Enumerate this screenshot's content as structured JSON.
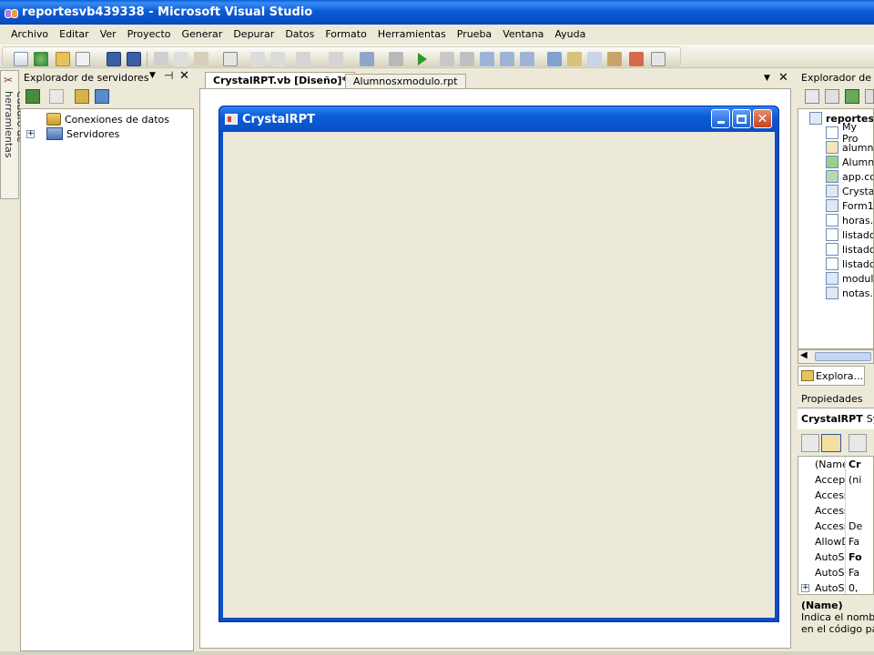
{
  "window": {
    "title": "reportesvb439338 - Microsoft Visual Studio"
  },
  "menu": [
    "Archivo",
    "Editar",
    "Ver",
    "Proyecto",
    "Generar",
    "Depurar",
    "Datos",
    "Formato",
    "Herramientas",
    "Prueba",
    "Ventana",
    "Ayuda"
  ],
  "toolbox": {
    "label": "Cuadro de herramientas"
  },
  "server_explorer": {
    "title": "Explorador de servidores",
    "items": [
      {
        "label": "Conexiones de datos"
      },
      {
        "label": "Servidores"
      }
    ]
  },
  "tabs": [
    {
      "label": "CrystalRPT.vb [Diseño]*",
      "active": true
    },
    {
      "label": "Alumnosxmodulo.rpt",
      "active": false
    }
  ],
  "form": {
    "title": "CrystalRPT"
  },
  "solution_explorer": {
    "title": "Explorador de s.",
    "root": "reportesv",
    "items": [
      "My Pro",
      "alumno",
      "Alumnc",
      "app.co",
      "Crystal",
      "Form1.",
      "horas.r",
      "listado",
      "listadoi",
      "listadoi",
      "modulo",
      "notas.v"
    ],
    "bottom_tab": "Explora..."
  },
  "properties": {
    "title": "Propiedades",
    "object": "CrystalRPT",
    "object_type": "Sy",
    "rows": [
      {
        "name": "(Name)",
        "value": "Cr"
      },
      {
        "name": "AcceptBut",
        "value": "(ni"
      },
      {
        "name": "Accessible",
        "value": ""
      },
      {
        "name": "Accessible",
        "value": ""
      },
      {
        "name": "Accessible",
        "value": "De"
      },
      {
        "name": "AllowDrop",
        "value": "Fa"
      },
      {
        "name": "AutoScale",
        "value": "Fo"
      },
      {
        "name": "AutoScroll",
        "value": "Fa"
      },
      {
        "name": "AutoScroll",
        "value": "0,"
      }
    ],
    "desc_title": "(Name)",
    "desc_line1": "Indica el nombre",
    "desc_line2": "en el código para"
  }
}
